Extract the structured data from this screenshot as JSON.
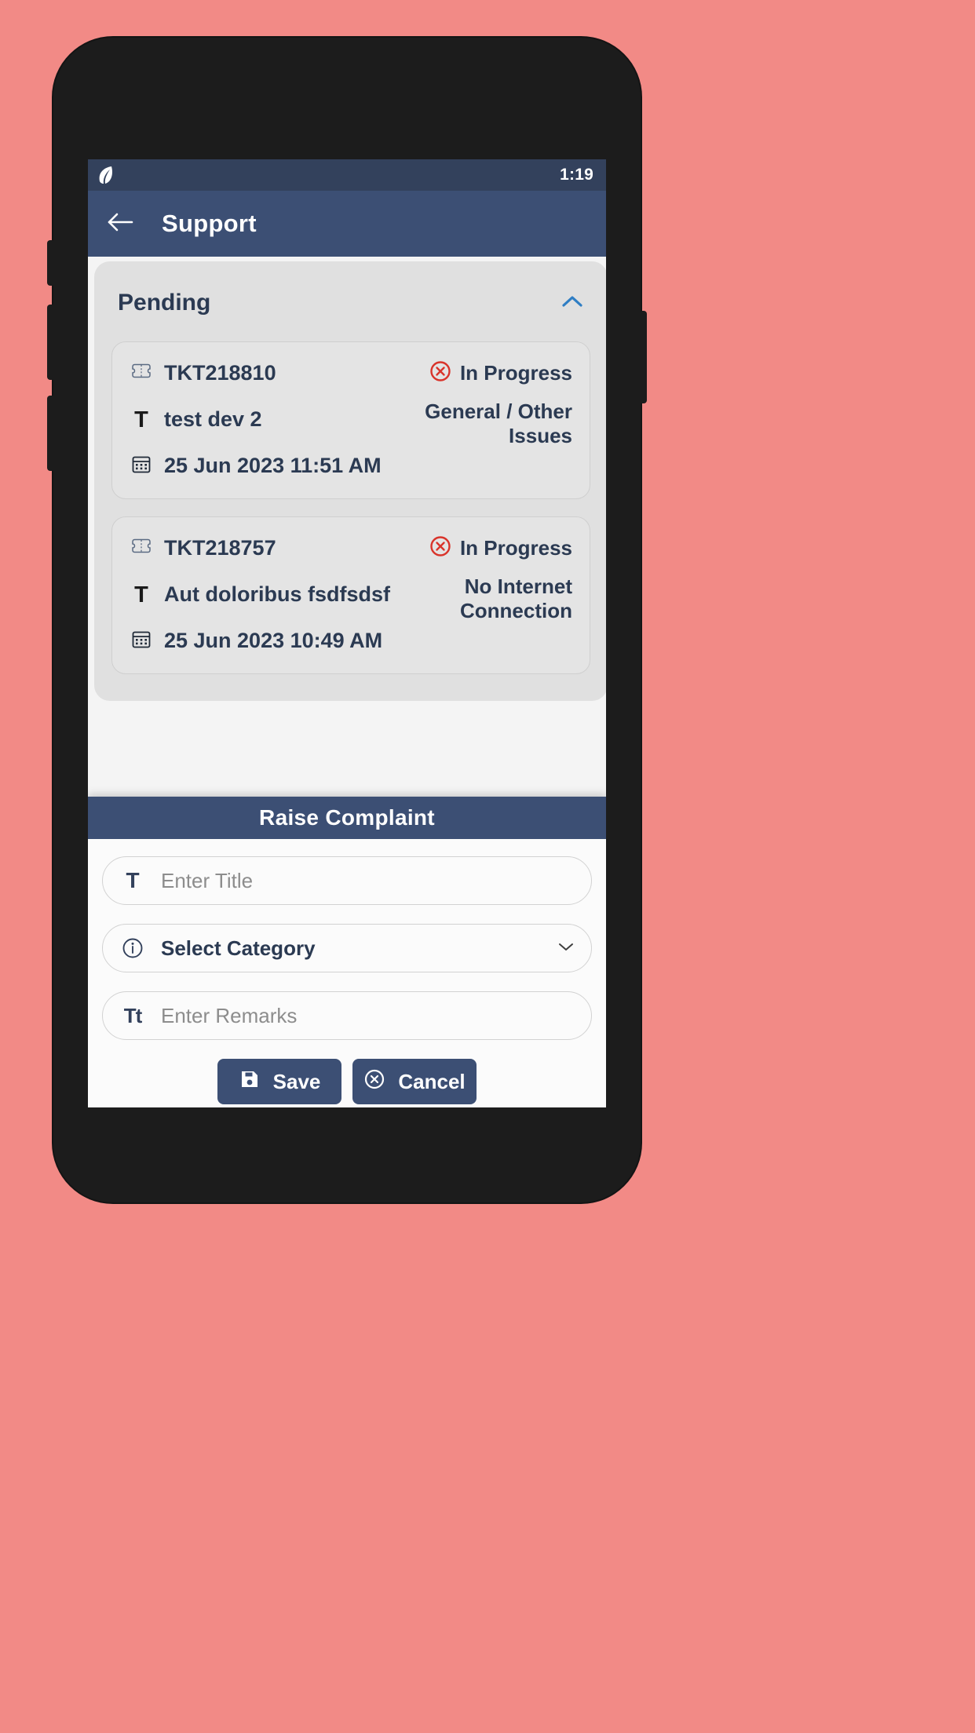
{
  "status_bar": {
    "time": "1:19",
    "app_icon": "leaf-icon"
  },
  "app_bar": {
    "back_icon": "back-arrow-icon",
    "title": "Support"
  },
  "pending_section": {
    "label": "Pending",
    "chevron_icon": "chevron-up-icon",
    "expanded": true,
    "tickets": [
      {
        "id": "TKT218810",
        "id_icon": "ticket-icon",
        "title": "test dev 2",
        "title_icon": "text-title-icon",
        "date": "25 Jun 2023 11:51 AM",
        "date_icon": "calendar-icon",
        "status": "In Progress",
        "status_icon": "x-circle-icon",
        "category": "General / Other Issues"
      },
      {
        "id": "TKT218757",
        "id_icon": "ticket-icon",
        "title": "Aut doloribus fsdfsdsf",
        "title_icon": "text-title-icon",
        "date": "25 Jun 2023 10:49 AM",
        "date_icon": "calendar-icon",
        "status": "In Progress",
        "status_icon": "x-circle-icon",
        "category": "No Internet Connection"
      }
    ]
  },
  "sheet": {
    "title": "Raise Complaint",
    "title_field": {
      "icon": "text-title-icon",
      "icon_glyph": "T",
      "placeholder": "Enter Title",
      "value": ""
    },
    "category_field": {
      "icon": "info-circle-icon",
      "label": "Select Category",
      "caret_icon": "caret-down-icon"
    },
    "remarks_field": {
      "icon": "text-format-icon",
      "icon_glyph": "Tt",
      "placeholder": "Enter Remarks",
      "value": ""
    },
    "save_button": {
      "label": "Save",
      "icon": "save-disk-icon"
    },
    "cancel_button": {
      "label": "Cancel",
      "icon": "x-circle-icon"
    }
  },
  "colors": {
    "background": "#f28a86",
    "primary": "#3c4f74",
    "status_bar": "#33415c",
    "text_dark": "#2b3a52",
    "danger": "#d9342b",
    "accent_blue": "#2f7ec4"
  }
}
